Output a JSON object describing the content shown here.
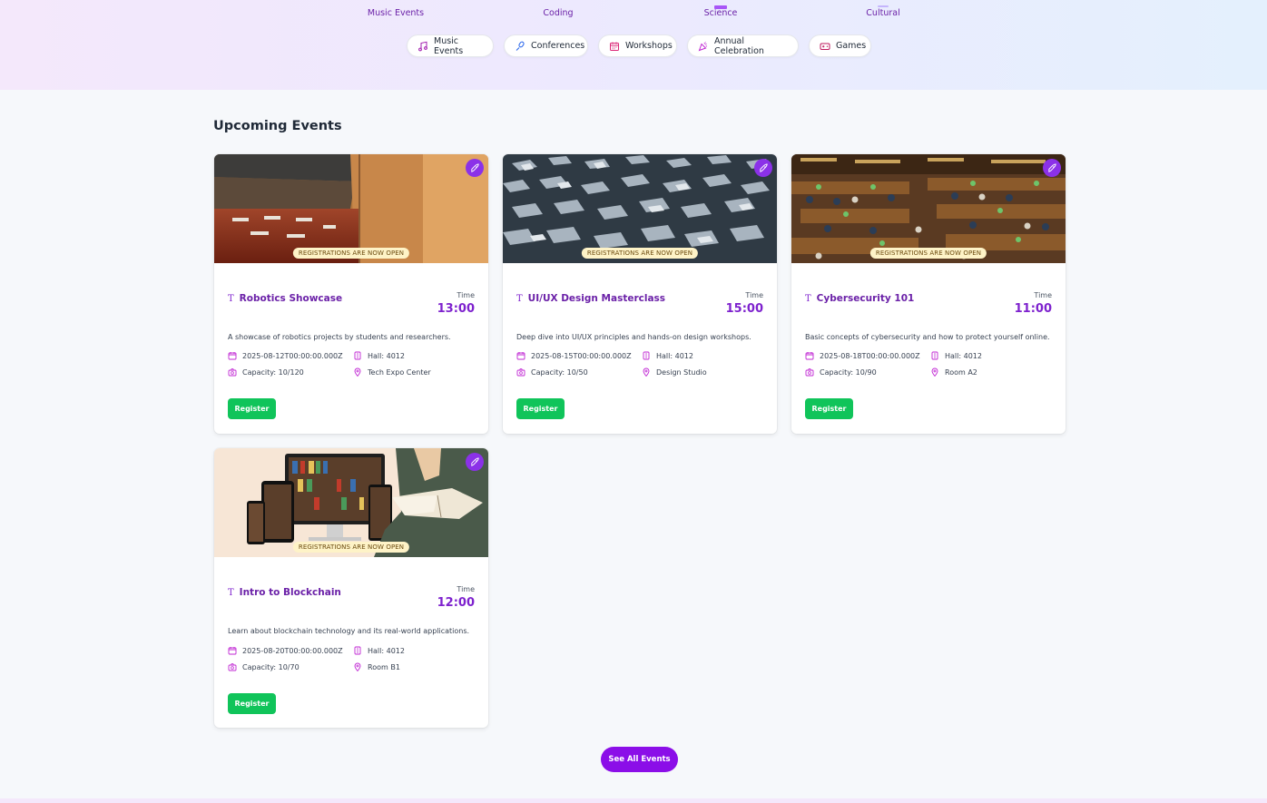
{
  "categories": [
    {
      "label": "Music Events"
    },
    {
      "label": "Coding"
    },
    {
      "label": "Science"
    },
    {
      "label": "Cultural"
    }
  ],
  "chips": [
    {
      "label": "Music Events",
      "icon": "music-note-icon"
    },
    {
      "label": "Conferences",
      "icon": "microphone-icon"
    },
    {
      "label": "Workshops",
      "icon": "calendar-icon"
    },
    {
      "label": "Annual Celebration",
      "icon": "party-popper-icon"
    },
    {
      "label": "Games",
      "icon": "gamepad-icon"
    }
  ],
  "section": {
    "title": "Upcoming Events"
  },
  "colors": {
    "accent": "#7e22ce",
    "register": "#10c45a",
    "see_all": "#8b0ee8",
    "badge": "#8b31e8"
  },
  "events": [
    {
      "title": "Robotics Showcase",
      "time_label": "Time",
      "time": "13:00",
      "banner": "REGISTRATIONS ARE NOW OPEN",
      "description": "A showcase of robotics projects by students and researchers.",
      "date": "2025-08-12T00:00:00.000Z",
      "hall": "Hall: 4012",
      "capacity": "Capacity: 10/120",
      "location": "Tech Expo Center",
      "register": "Register"
    },
    {
      "title": "UI/UX Design Masterclass",
      "time_label": "Time",
      "time": "15:00",
      "banner": "REGISTRATIONS ARE NOW OPEN",
      "description": "Deep dive into UI/UX principles and hands-on design workshops.",
      "date": "2025-08-15T00:00:00.000Z",
      "hall": "Hall: 4012",
      "capacity": "Capacity: 10/50",
      "location": "Design Studio",
      "register": "Register"
    },
    {
      "title": "Cybersecurity 101",
      "time_label": "Time",
      "time": "11:00",
      "banner": "REGISTRATIONS ARE NOW OPEN",
      "description": "Basic concepts of cybersecurity and how to protect yourself online.",
      "date": "2025-08-18T00:00:00.000Z",
      "hall": "Hall: 4012",
      "capacity": "Capacity: 10/90",
      "location": "Room A2",
      "register": "Register"
    },
    {
      "title": "Intro to Blockchain",
      "time_label": "Time",
      "time": "12:00",
      "banner": "REGISTRATIONS ARE NOW OPEN",
      "description": "Learn about blockchain technology and its real-world applications.",
      "date": "2025-08-20T00:00:00.000Z",
      "hall": "Hall: 4012",
      "capacity": "Capacity: 10/70",
      "location": "Room B1",
      "register": "Register"
    }
  ],
  "see_all": "See All Events"
}
